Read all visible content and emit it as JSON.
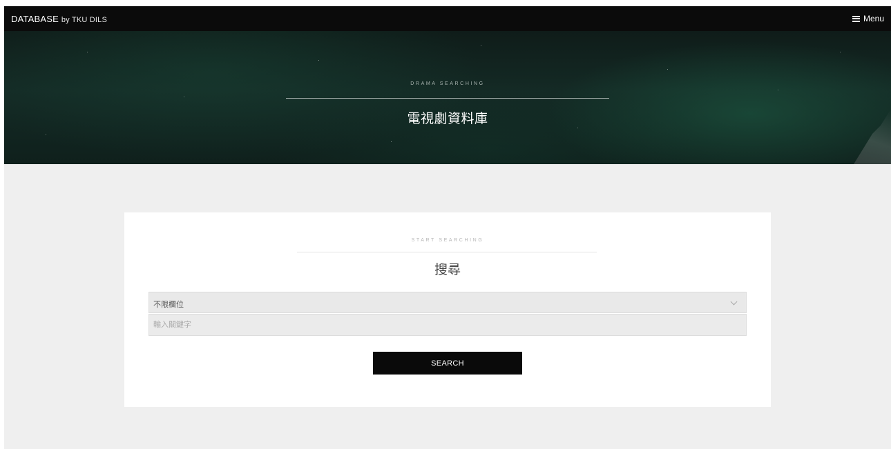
{
  "nav": {
    "brand": "DATABASE",
    "brand_by": "by TKU DILS",
    "menu_label": "Menu",
    "menu_icon": "hamburger-icon"
  },
  "hero": {
    "kicker": "DRAMA SEARCHING",
    "title": "電視劇資料庫"
  },
  "search": {
    "kicker": "START SEARCHING",
    "title": "搜尋",
    "field_select": {
      "selected": "不限欄位",
      "icon": "chevron-down-icon"
    },
    "keyword": {
      "value": "",
      "placeholder": "輸入關鍵字"
    },
    "button_label": "SEARCH"
  },
  "colors": {
    "topbar": "#0b0b0b",
    "page_bg": "#efefef",
    "button": "#0a0a0a"
  }
}
